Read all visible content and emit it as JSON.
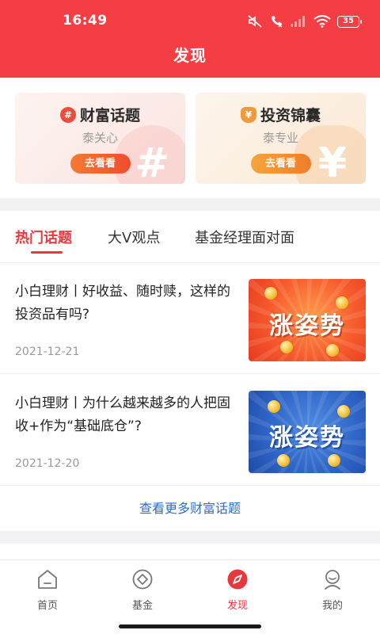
{
  "status_bar": {
    "time": "16:49",
    "battery": "35",
    "icons": [
      "mute-icon",
      "call-forward-icon",
      "signal-icon",
      "wifi-icon",
      "battery-icon"
    ]
  },
  "header": {
    "title": "发现",
    "background_color": "#f43e44"
  },
  "feature_cards": [
    {
      "icon": "hash-icon",
      "icon_glyph": "#",
      "title": "财富话题",
      "subtitle": "泰关心",
      "button": "去看看",
      "bg_glyph": "#"
    },
    {
      "icon": "money-bag-icon",
      "icon_glyph": "¥",
      "title": "投资锦囊",
      "subtitle": "泰专业",
      "button": "去看看",
      "bg_glyph": "¥"
    }
  ],
  "topic_tabs": [
    {
      "label": "热门话题",
      "active": true
    },
    {
      "label": "大V观点",
      "active": false
    },
    {
      "label": "基金经理面对面",
      "active": false
    }
  ],
  "articles": [
    {
      "title": "小白理财丨好收益、随时赎，这样的投资品有吗?",
      "date": "2021-12-21",
      "thumb_text": "涨姿势",
      "thumb_color": "#f65a2c"
    },
    {
      "title": "小白理财丨为什么越来越多的人把固收+作为“基础底仓”?",
      "date": "2021-12-20",
      "thumb_text": "涨姿势",
      "thumb_color": "#2f66c8"
    }
  ],
  "more_link": "查看更多财富话题",
  "tabbar": {
    "items": [
      {
        "label": "首页",
        "icon": "home-icon",
        "active": false
      },
      {
        "label": "基金",
        "icon": "fund-icon",
        "active": false
      },
      {
        "label": "发现",
        "icon": "discover-icon",
        "active": true
      },
      {
        "label": "我的",
        "icon": "profile-icon",
        "active": false
      }
    ]
  },
  "colors": {
    "accent": "#e8383d",
    "link": "#2a6fc9"
  }
}
